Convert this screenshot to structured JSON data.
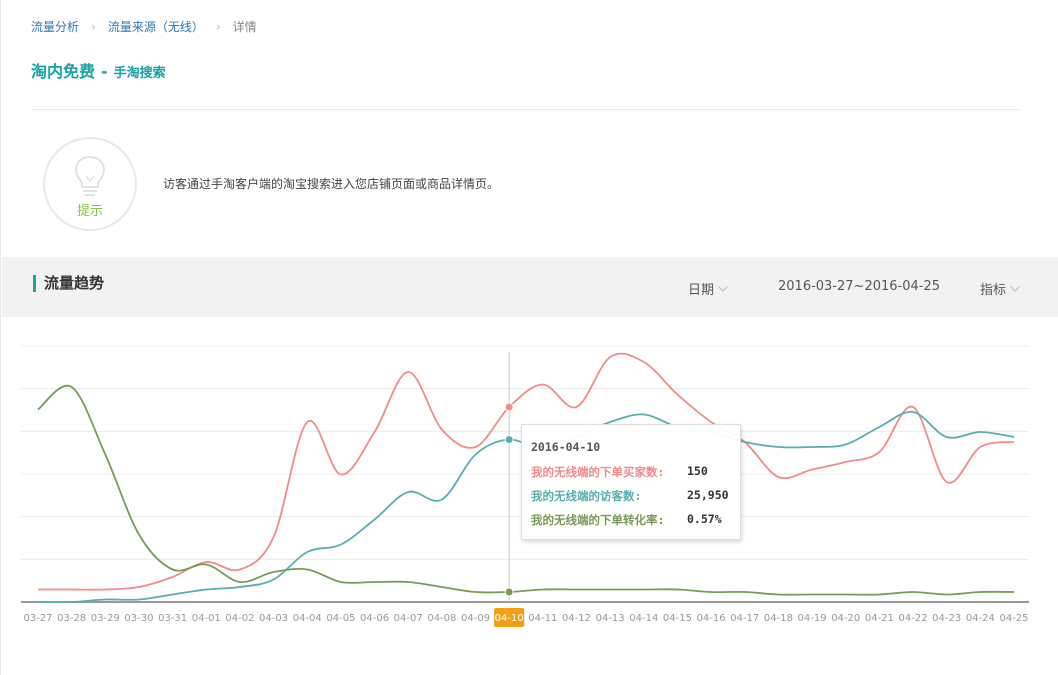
{
  "breadcrumb": {
    "items": [
      "流量分析",
      "流量来源（无线）",
      "详情"
    ]
  },
  "title": {
    "main": "淘内免费",
    "dash": "-",
    "sub": "手淘搜索"
  },
  "tip": {
    "label": "提示",
    "text": "访客通过手淘客户端的淘宝搜索进入您店铺页面或商品详情页。"
  },
  "trend": {
    "title": "流量趋势",
    "date_label": "日期",
    "date_range": "2016-03-27~2016-04-25",
    "metric_label": "指标"
  },
  "colors": {
    "accent": "#19a3a3",
    "link": "#2f78b0",
    "buyers": "#f28b8b",
    "visitors": "#5aaeb0",
    "conversion": "#7a9a5a",
    "highlight": "#f0a010"
  },
  "tooltip": {
    "date": "2016-04-10",
    "rows": [
      {
        "label": "我的无线端的下单买家数:",
        "value": "150"
      },
      {
        "label": "我的无线端的访客数:",
        "value": "25,950"
      },
      {
        "label": "我的无线端的下单转化率:",
        "value": "0.57%"
      }
    ]
  },
  "chart_data": {
    "type": "line",
    "x": [
      "03-27",
      "03-28",
      "03-29",
      "03-30",
      "03-31",
      "04-01",
      "04-02",
      "04-03",
      "04-04",
      "04-05",
      "04-06",
      "04-07",
      "04-08",
      "04-09",
      "04-10",
      "04-11",
      "04-12",
      "04-13",
      "04-14",
      "04-15",
      "04-16",
      "04-17",
      "04-18",
      "04-19",
      "04-20",
      "04-21",
      "04-22",
      "04-23",
      "04-24",
      "04-25"
    ],
    "highlighted_x": "04-10",
    "grid": true,
    "ylim": [
      0,
      1
    ],
    "series": [
      {
        "name": "我的无线端的下单买家数",
        "color": "#f28b8b",
        "values": [
          0.05,
          0.05,
          0.05,
          0.06,
          0.1,
          0.16,
          0.13,
          0.26,
          0.72,
          0.51,
          0.68,
          0.92,
          0.69,
          0.62,
          0.78,
          0.87,
          0.78,
          0.98,
          0.96,
          0.83,
          0.72,
          0.64,
          0.5,
          0.53,
          0.56,
          0.6,
          0.78,
          0.48,
          0.62,
          0.64
        ]
      },
      {
        "name": "我的无线端的访客数",
        "color": "#5aaeb0",
        "values": [
          0.0,
          0.0,
          0.01,
          0.01,
          0.03,
          0.05,
          0.06,
          0.09,
          0.2,
          0.23,
          0.33,
          0.44,
          0.41,
          0.59,
          0.65,
          0.61,
          0.66,
          0.72,
          0.75,
          0.7,
          0.68,
          0.64,
          0.62,
          0.62,
          0.63,
          0.7,
          0.76,
          0.66,
          0.68,
          0.66
        ]
      },
      {
        "name": "我的无线端的下单转化率",
        "color": "#7a9a5a",
        "values": [
          0.77,
          0.86,
          0.59,
          0.27,
          0.13,
          0.15,
          0.08,
          0.12,
          0.13,
          0.08,
          0.08,
          0.08,
          0.06,
          0.04,
          0.04,
          0.05,
          0.05,
          0.05,
          0.05,
          0.05,
          0.04,
          0.04,
          0.03,
          0.03,
          0.03,
          0.03,
          0.04,
          0.03,
          0.04,
          0.04
        ]
      }
    ]
  }
}
